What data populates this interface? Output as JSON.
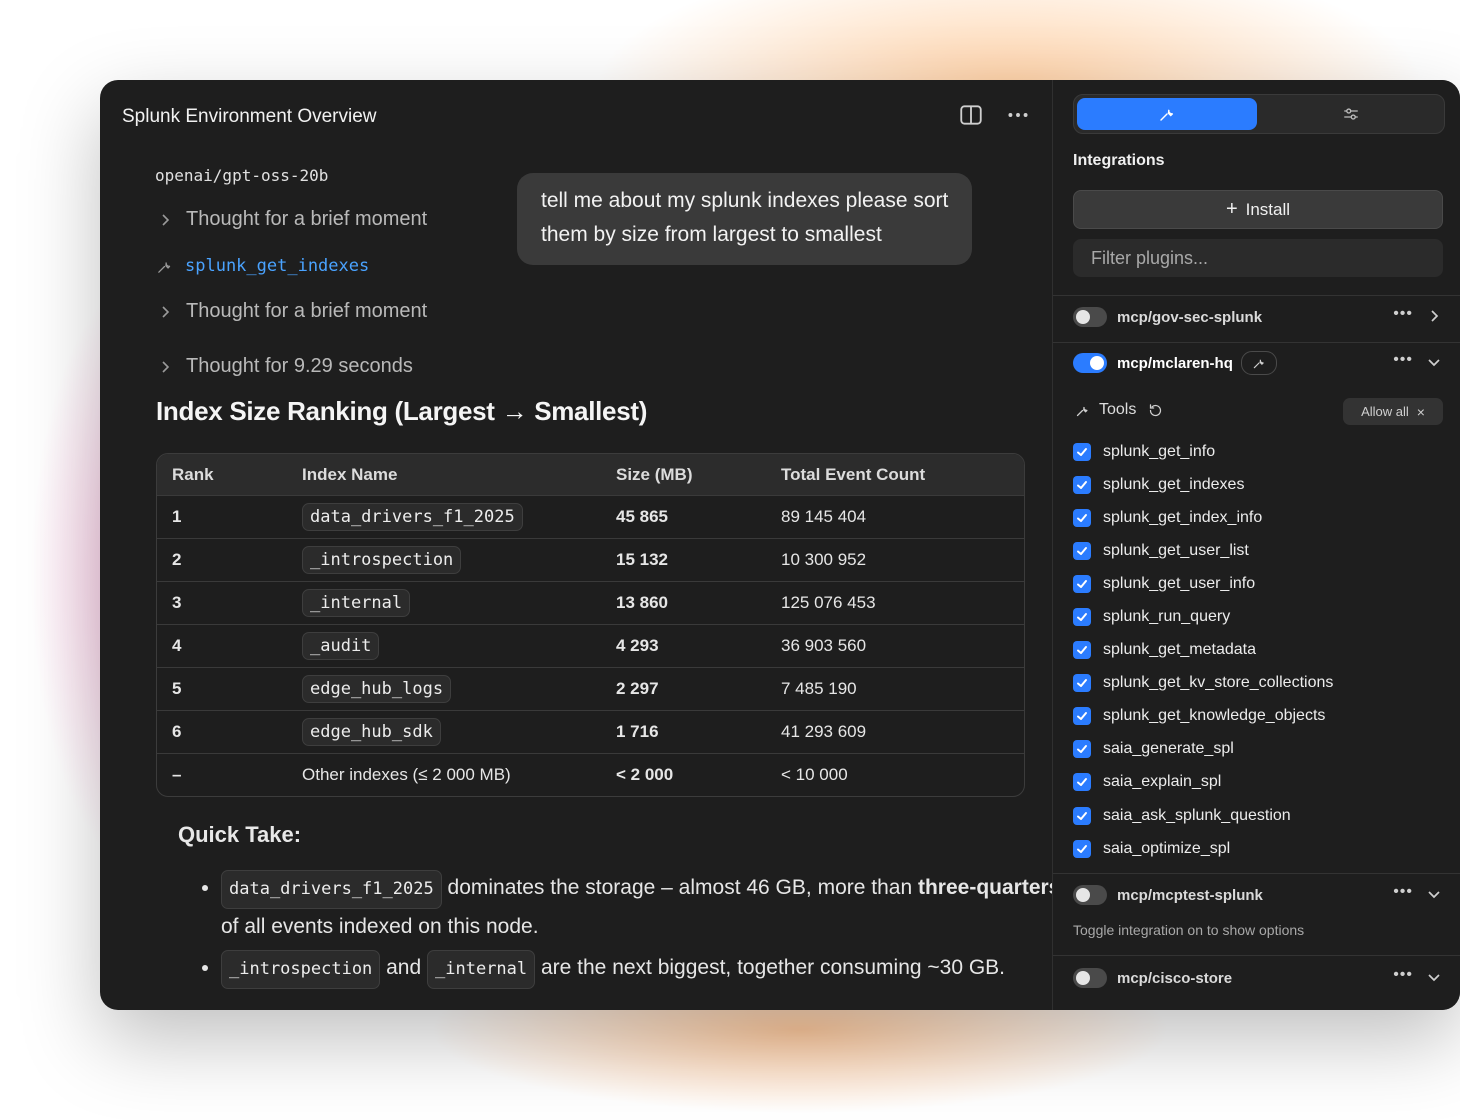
{
  "app": {
    "title": "Splunk Environment Overview"
  },
  "toolbar": {
    "split_icon": "sidebar-split-icon",
    "more_icon": "more-icon"
  },
  "chat": {
    "model": "openai/gpt-oss-20b",
    "user_message": "tell me about my splunk indexes please sort them by size from largest  to smallest",
    "steps": [
      {
        "type": "thought",
        "label": "Thought for a brief moment"
      },
      {
        "type": "tool",
        "label": "splunk_get_indexes"
      },
      {
        "type": "thought",
        "label": "Thought for a brief moment"
      },
      {
        "type": "thought",
        "label": "Thought for 9.29 seconds"
      }
    ],
    "heading": "Index Size Ranking (Largest → Smallest)",
    "table": {
      "headers": [
        "Rank",
        "Index Name",
        "Size (MB)",
        "Total Event Count"
      ],
      "rows": [
        {
          "rank": "1",
          "name": "data_drivers_f1_2025",
          "size": "45 865",
          "events": "89 145 404",
          "code": true
        },
        {
          "rank": "2",
          "name": "_introspection",
          "size": "15 132",
          "events": "10 300 952",
          "code": true
        },
        {
          "rank": "3",
          "name": "_internal",
          "size": "13 860",
          "events": "125 076 453",
          "code": true
        },
        {
          "rank": "4",
          "name": "_audit",
          "size": "4 293",
          "events": "36 903 560",
          "code": true
        },
        {
          "rank": "5",
          "name": "edge_hub_logs",
          "size": "2 297",
          "events": "7 485 190",
          "code": true
        },
        {
          "rank": "6",
          "name": "edge_hub_sdk",
          "size": "1 716",
          "events": "41 293 609",
          "code": true
        },
        {
          "rank": "–",
          "name": "Other indexes (≤ 2 000 MB)",
          "size": "< 2 000",
          "events": "< 10 000",
          "code": false
        }
      ]
    },
    "quick_take": {
      "title": "Quick Take:",
      "b1_code": "data_drivers_f1_2025",
      "b1_text": " dominates the storage – almost 46 GB, more than ",
      "b1_bold": "three-quarters",
      "b1_tail": " of all events indexed on this node.",
      "b2_code1": "_introspection",
      "b2_and": " and ",
      "b2_code2": "_internal",
      "b2_text": " are the next biggest, together consuming ~30 GB."
    }
  },
  "sidebar": {
    "tab_tools_icon": "wrench-icon",
    "tab_settings_icon": "sliders-icon",
    "integrations_label": "Integrations",
    "install_label": "Install",
    "filter_placeholder": "Filter plugins...",
    "plugins": [
      {
        "name": "mcp/gov-sec-splunk",
        "enabled": false
      },
      {
        "name": "mcp/mclaren-hq",
        "enabled": true
      },
      {
        "name": "mcp/mcptest-splunk",
        "enabled": false
      },
      {
        "name": "mcp/cisco-store",
        "enabled": false
      }
    ],
    "tools_label": "Tools",
    "allow_all_label": "Allow all",
    "tools": [
      "splunk_get_info",
      "splunk_get_indexes",
      "splunk_get_index_info",
      "splunk_get_user_list",
      "splunk_get_user_info",
      "splunk_run_query",
      "splunk_get_metadata",
      "splunk_get_kv_store_collections",
      "splunk_get_knowledge_objects",
      "saia_generate_spl",
      "saia_explain_spl",
      "saia_ask_splunk_question",
      "saia_optimize_spl"
    ],
    "toggle_note": "Toggle integration on to show options",
    "accent_color": "#2b7cff"
  }
}
